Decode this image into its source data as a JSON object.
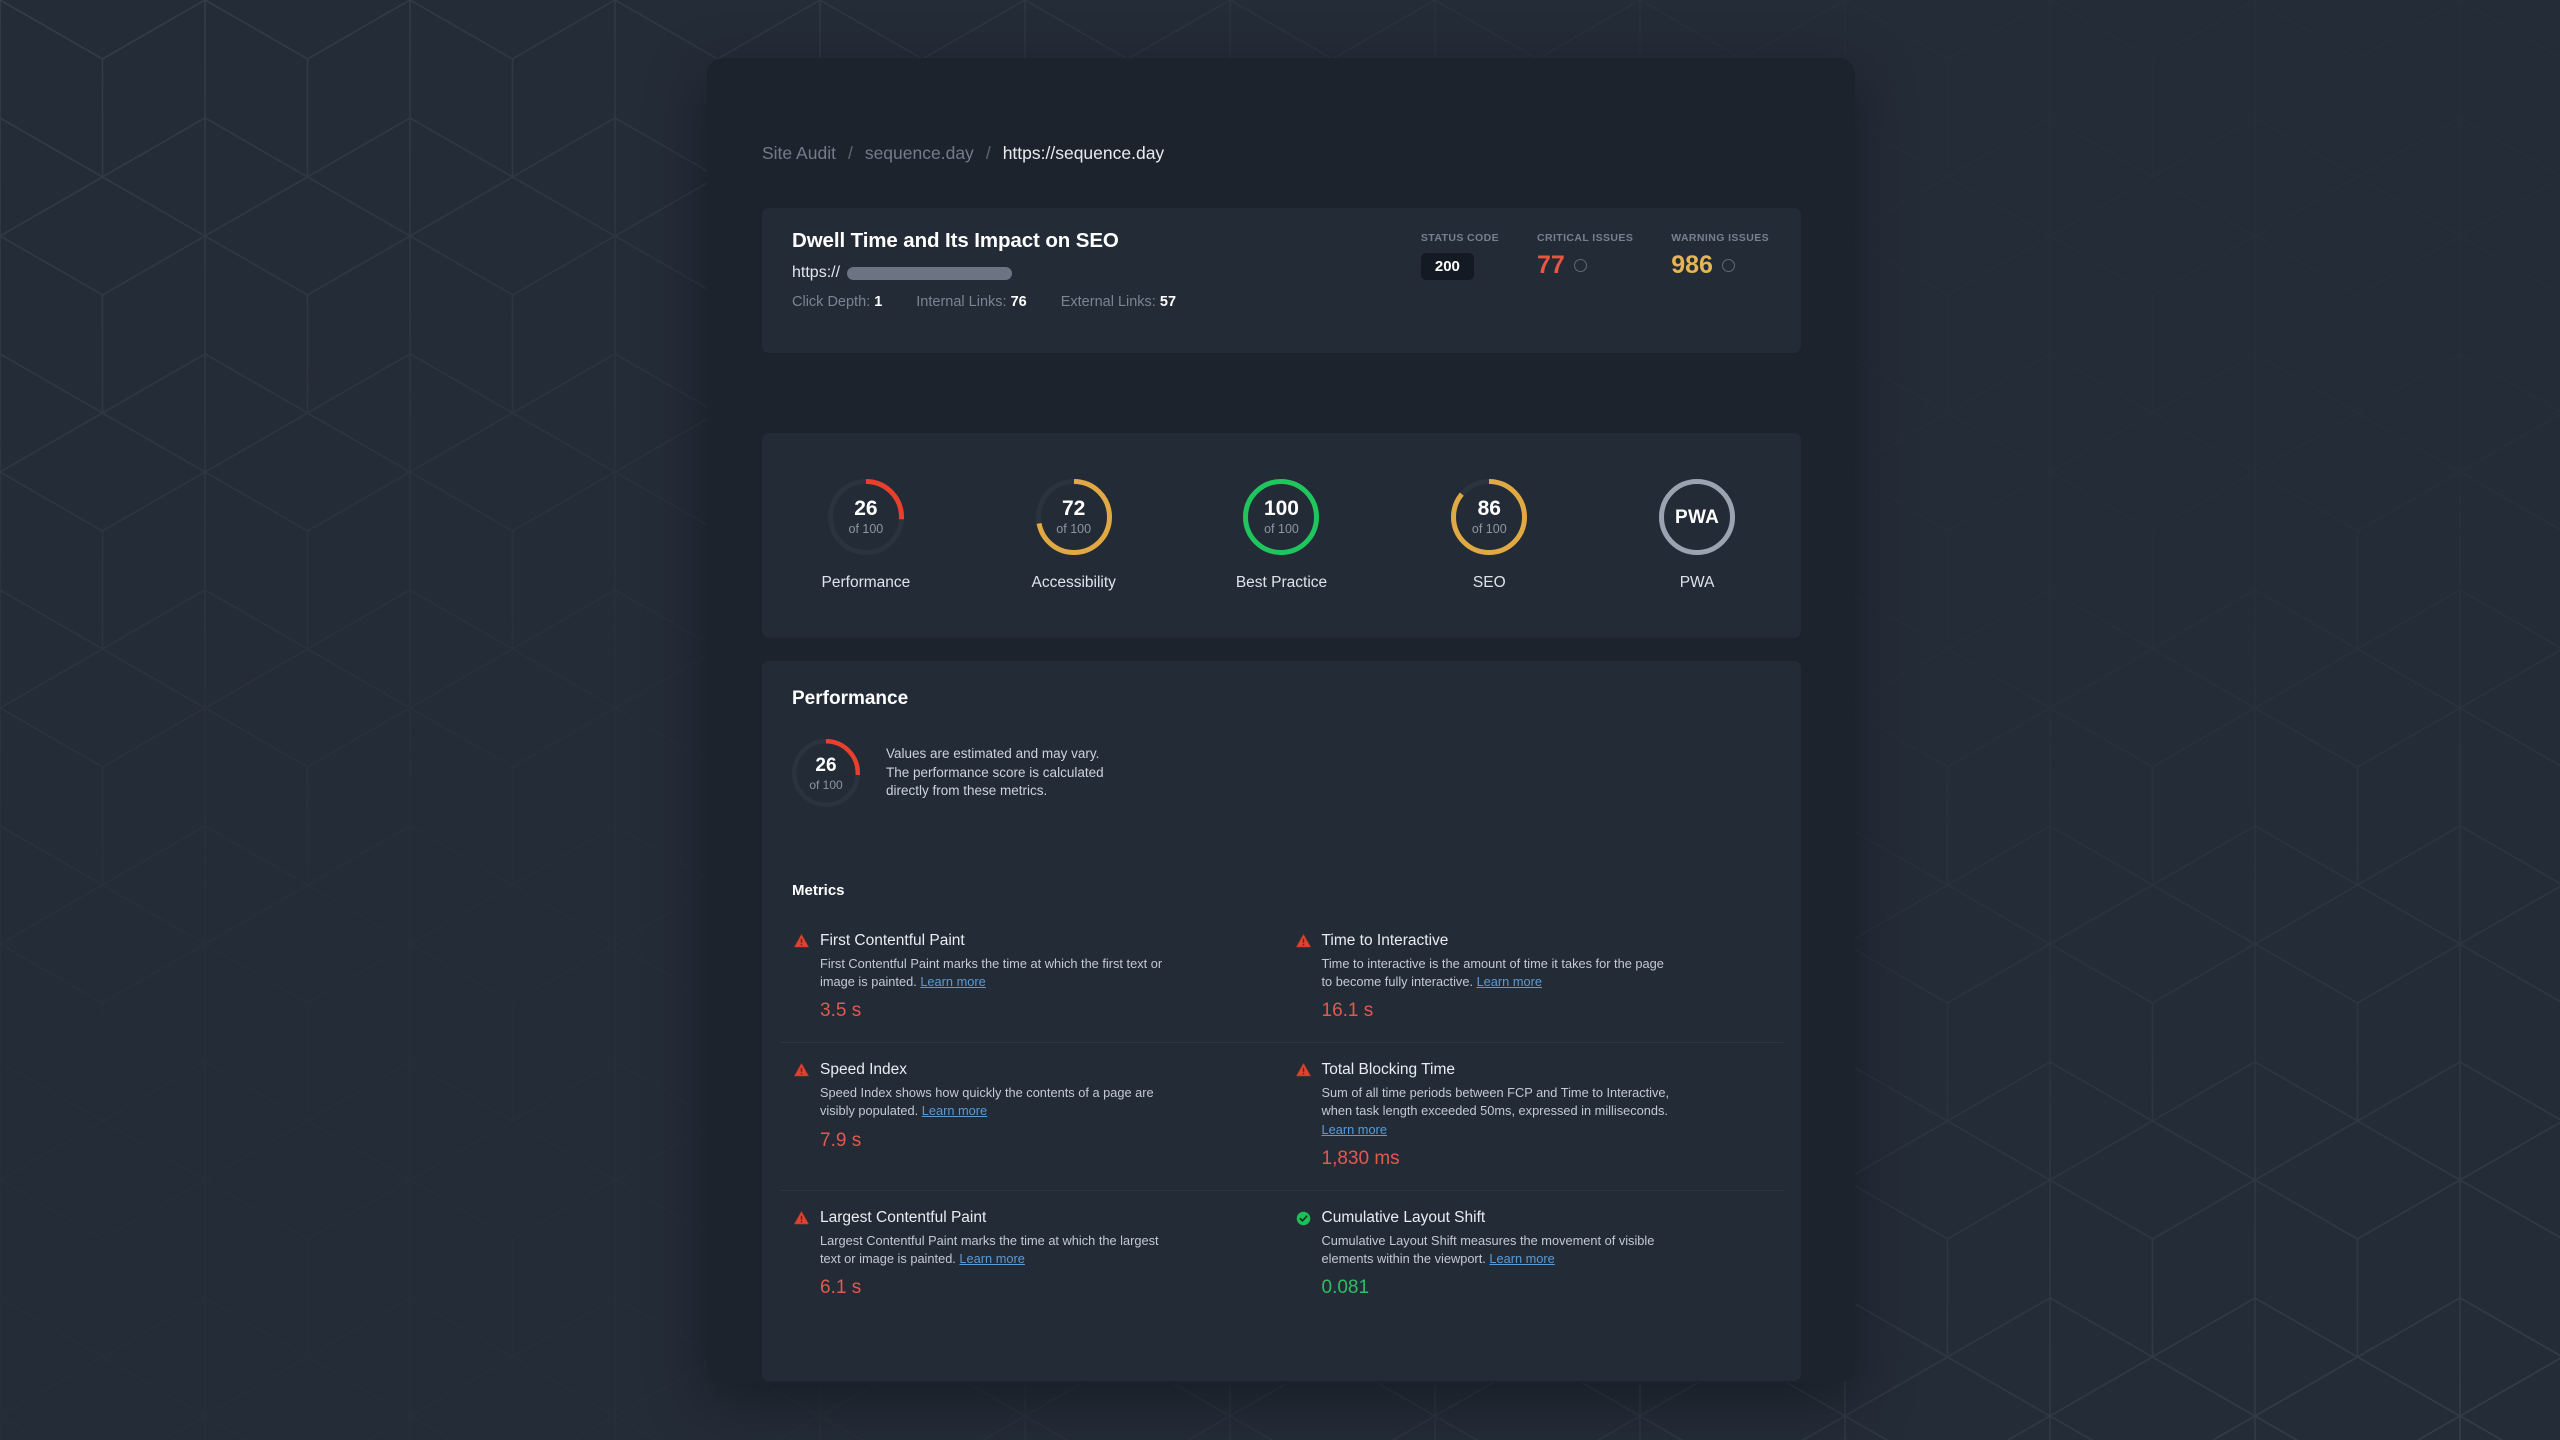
{
  "background": {
    "pattern": "isometric-triangles",
    "page_color": "#242c38",
    "window_color": "#1d232d"
  },
  "breadcrumb": {
    "items": [
      {
        "label": "Site Audit",
        "active": false
      },
      {
        "label": "sequence.day",
        "active": false
      },
      {
        "label": "https://sequence.day",
        "active": true
      }
    ],
    "separator": "/"
  },
  "header": {
    "title": "Dwell Time and Its Impact on SEO",
    "url_scheme": "https://",
    "url_redacted": true,
    "link_stats": [
      {
        "label": "Click Depth:",
        "value": "1"
      },
      {
        "label": "Internal Links:",
        "value": "76"
      },
      {
        "label": "External Links:",
        "value": "57"
      }
    ],
    "stats": [
      {
        "name": "status-code",
        "label": "STATUS CODE",
        "value": "200",
        "style": "pill",
        "color": "#ffffff"
      },
      {
        "name": "critical-issues",
        "label": "CRITICAL ISSUES",
        "value": "77",
        "style": "big",
        "color": "#e8563f",
        "ring": true
      },
      {
        "name": "warning-issues",
        "label": "WARNING ISSUES",
        "value": "986",
        "style": "big",
        "color": "#e5b454",
        "ring": true
      }
    ]
  },
  "scores": [
    {
      "name": "performance",
      "value": "26",
      "sub": "of 100",
      "label": "Performance",
      "percent": 26,
      "color": "#e8402c"
    },
    {
      "name": "accessibility",
      "value": "72",
      "sub": "of 100",
      "label": "Accessibility",
      "percent": 72,
      "color": "#e0a943"
    },
    {
      "name": "best-practice",
      "value": "100",
      "sub": "of 100",
      "label": "Best Practice",
      "percent": 100,
      "color": "#1fc65e"
    },
    {
      "name": "seo",
      "value": "86",
      "sub": "of 100",
      "label": "SEO",
      "percent": 86,
      "color": "#e0a943"
    },
    {
      "name": "pwa",
      "value": "PWA",
      "sub": "",
      "label": "PWA",
      "percent": 100,
      "color": "#9aa3af"
    }
  ],
  "performance": {
    "section_title": "Performance",
    "score": {
      "value": "26",
      "sub": "of 100",
      "percent": 26,
      "color": "#e8402c"
    },
    "note": "Values are estimated and may vary.\nThe performance score is calculated\ndirectly from these metrics.",
    "metrics_title": "Metrics",
    "learn_more": "Learn more",
    "metrics": [
      {
        "name": "first-contentful-paint",
        "status": "warning",
        "title": "First Contentful Paint",
        "description": "First Contentful Paint marks the time at which the first text or image is painted.",
        "value": "3.5 s",
        "value_color": "#e05a4e"
      },
      {
        "name": "time-to-interactive",
        "status": "warning",
        "title": "Time to Interactive",
        "description": "Time to interactive is the amount of time it takes for the page to become fully interactive.",
        "value": "16.1 s",
        "value_color": "#e05a4e"
      },
      {
        "name": "speed-index",
        "status": "warning",
        "title": "Speed Index",
        "description": "Speed Index shows how quickly the contents of a page are visibly populated.",
        "value": "7.9 s",
        "value_color": "#e05a4e"
      },
      {
        "name": "total-blocking-time",
        "status": "warning",
        "title": "Total Blocking Time",
        "description": "Sum of all time periods between FCP and Time to Interactive, when task length exceeded 50ms, expressed in milliseconds.",
        "value": "1,830 ms",
        "value_color": "#e05a4e"
      },
      {
        "name": "largest-contentful-paint",
        "status": "warning",
        "title": "Largest Contentful Paint",
        "description": "Largest Contentful Paint marks the time at which the largest text or image is painted.",
        "value": "6.1 s",
        "value_color": "#e05a4e"
      },
      {
        "name": "cumulative-layout-shift",
        "status": "pass",
        "title": "Cumulative Layout Shift",
        "description": "Cumulative Layout Shift measures the movement of visible elements within the viewport.",
        "value": "0.081",
        "value_color": "#2fbf63"
      }
    ]
  }
}
